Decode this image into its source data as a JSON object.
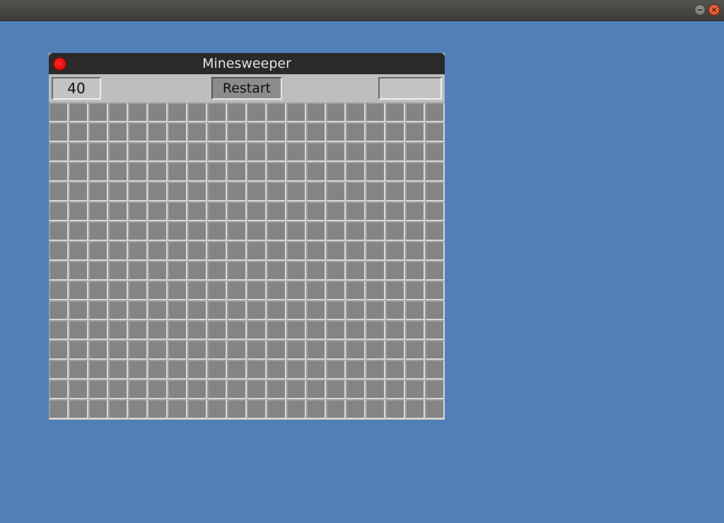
{
  "window": {
    "title": "Minesweeper"
  },
  "header": {
    "mine_count": "40",
    "restart_label": "Restart",
    "timer": ""
  },
  "board": {
    "rows": 16,
    "cols": 20,
    "state": "all-covered"
  },
  "system_bar": {
    "minimize_icon": "minimize-icon",
    "close_icon": "close-icon"
  },
  "colors": {
    "desktop": "#5080b7",
    "titlebar": "#2a2a2a",
    "window_bg": "#bdbdbd",
    "cell": "#848484",
    "close_dot": "#ff2a2a"
  }
}
